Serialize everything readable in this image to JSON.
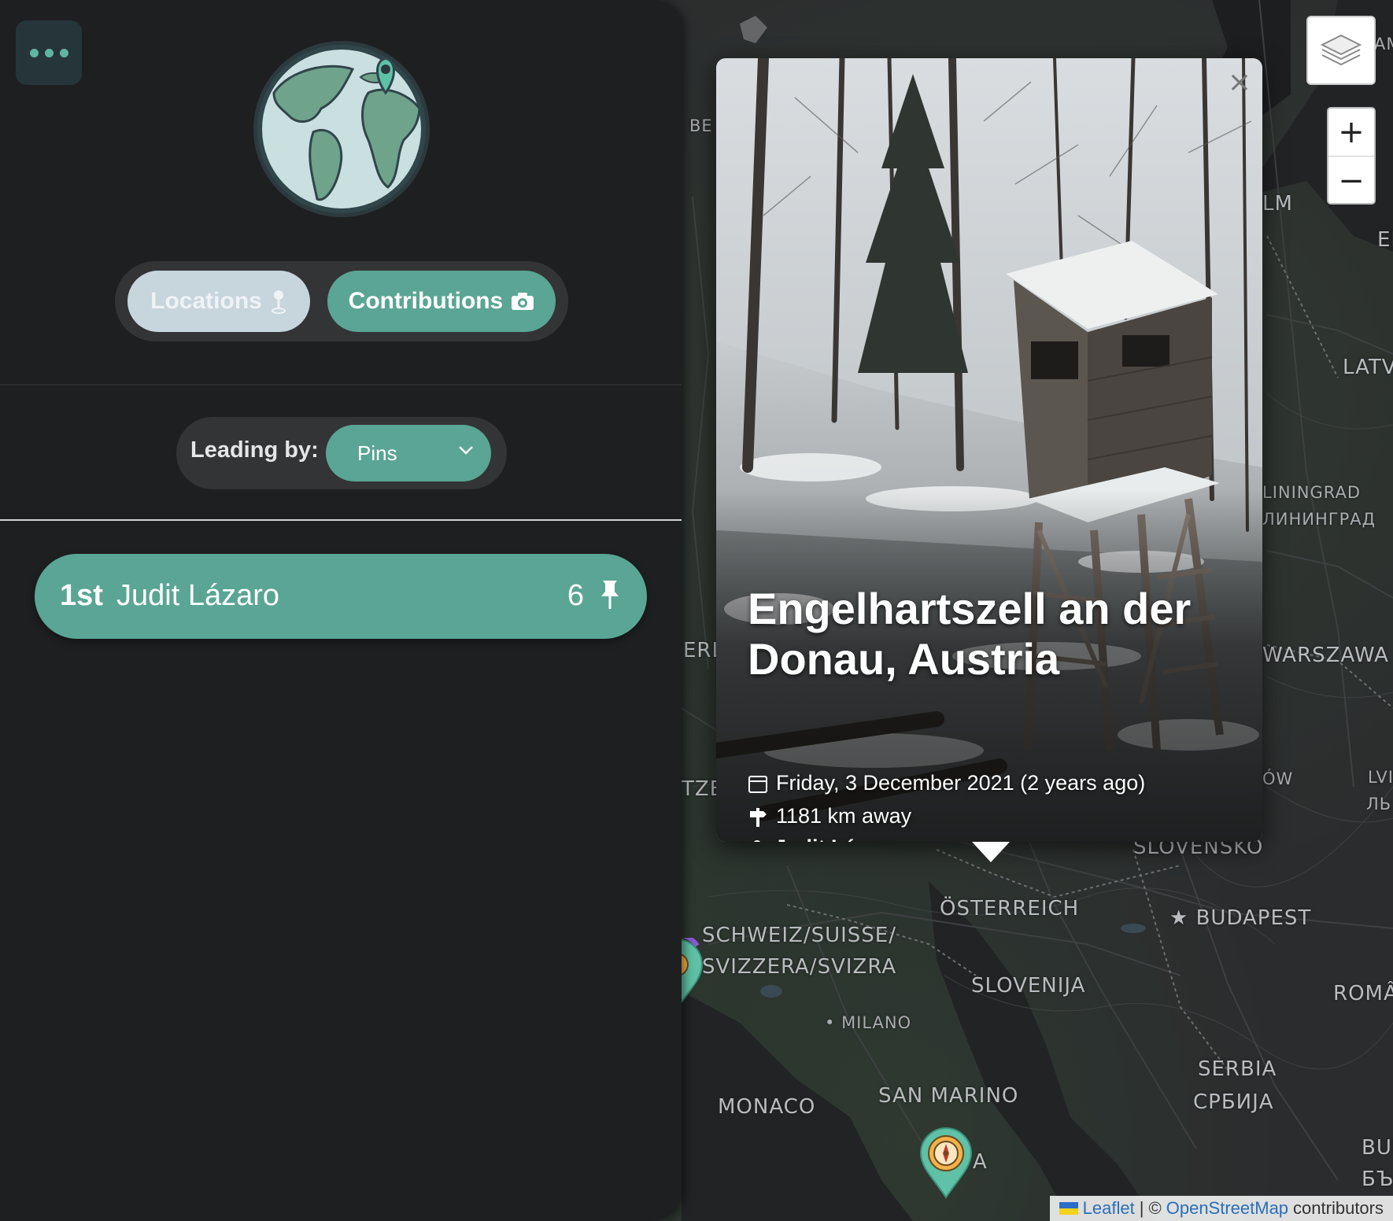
{
  "sidebar": {
    "menu_icon": "ellipsis-icon",
    "globe_icon": "globe-with-pin-icon",
    "toggle": {
      "locations_label": "Locations",
      "contributions_label": "Contributions",
      "active": "Contributions"
    },
    "leading_by": {
      "label": "Leading by:",
      "selected": "Pins"
    },
    "leaderboard": [
      {
        "rank": "1st",
        "name": "Judit Lázaro",
        "count": "6",
        "icon": "pushpin-icon"
      }
    ]
  },
  "popup": {
    "title": "Engelhartszell an der Donau, Austria",
    "date": "Friday, 3 December 2021 (2 years ago)",
    "distance": "1181 km away",
    "author": "Judit Lázaro",
    "close_label": "×"
  },
  "map": {
    "labels": {
      "be": "BE",
      "lm": "LM",
      "ee": "EE",
      "am": "AM",
      "latv": "LATV",
      "liningrad": "LININGRAD",
      "liningrad_cyr": "ЛИНИНГРАД",
      "warszawa": "WARSZAWA",
      "erl": "ERL",
      "tze": "TZE",
      "ow": "ÓW",
      "lvi": "LVI",
      "lvi_cyr": "ЛЬ",
      "slovensko": "SLOVENSKO",
      "osterreich": "ÖSTERREICH",
      "budapest": "BUDAPEST",
      "schweiz1": "SCHWEIZ/SUISSE/",
      "schweiz2": "SVIZZERA/SVIZRA",
      "slovenija": "SLOVENIJA",
      "roma": "ROMÂ",
      "milano": "MILANO",
      "serbia": "SERBIA",
      "serbia_cyr": "СРБИЈА",
      "monaco": "MONACO",
      "san_marino": "SAN MARINO",
      "a": "A",
      "bu": "BUI",
      "bu_cyr": "БЪ"
    },
    "controls": {
      "zoom_in": "+",
      "zoom_out": "−",
      "layers_icon": "layers-icon"
    },
    "attribution": {
      "leaflet": "Leaflet",
      "separator": "| ©",
      "osm": "OpenStreetMap",
      "suffix": "contributors"
    }
  },
  "colors": {
    "accent": "#5aa593",
    "sidebar_bg": "#1e1f21",
    "toggle_inactive": "#c7d5dd"
  }
}
